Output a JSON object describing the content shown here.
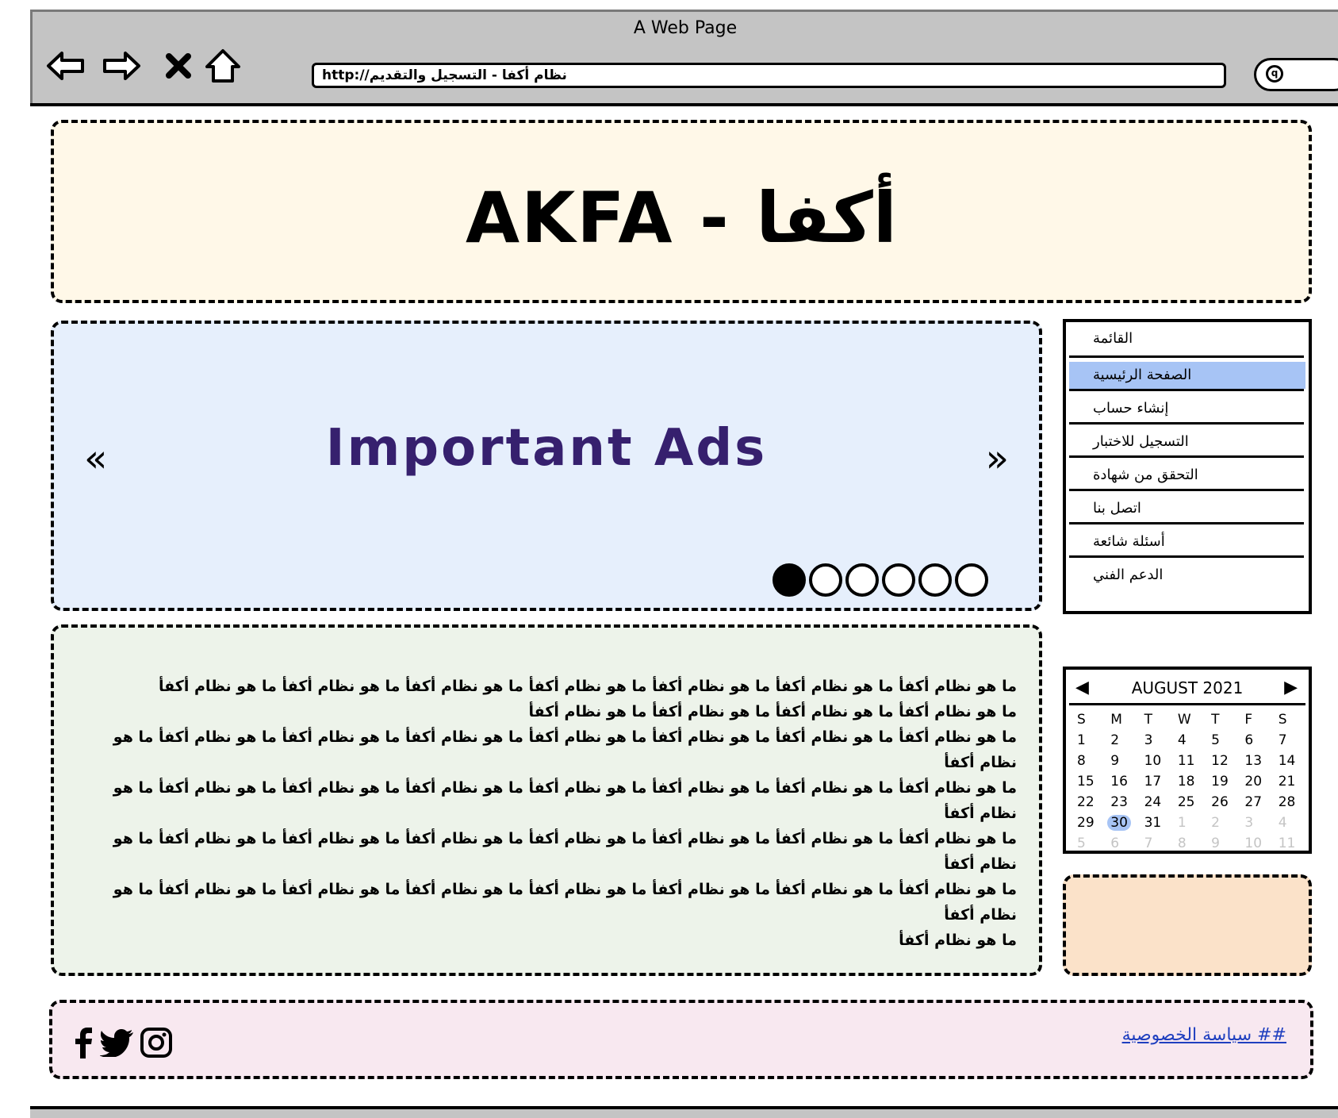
{
  "window": {
    "title": "A Web Page"
  },
  "toolbar": {
    "url": "http://نظام أكفا - التسجيل والتقديم"
  },
  "header": {
    "title": "AKFA - أكفا"
  },
  "ads": {
    "title": "Important Ads",
    "prev_label": "«",
    "next_label": "»",
    "slide_count": 6,
    "active_slide": 1
  },
  "content": {
    "lines": [
      "ما هو نظام أكفأ ما هو نظام أكفأ ما هو نظام أكفأ ما هو نظام أكفأ ما هو نظام أكفأ ما هو نظام أكفأ ما هو نظام أكفأ",
      "ما هو نظام أكفأ ما هو نظام أكفأ ما هو نظام أكفأ ما هو نظام أكفأ",
      "ما هو نظام أكفأ ما هو نظام أكفأ ما هو نظام أكفأ ما هو نظام أكفأ ما هو نظام أكفأ ما هو نظام أكفأ ما هو نظام أكفأ ما هو نظام أكفأ",
      "ما هو نظام أكفأ ما هو نظام أكفأ ما هو نظام أكفأ ما هو نظام أكفأ ما هو نظام أكفأ ما هو نظام أكفأ ما هو نظام أكفأ ما هو نظام أكفأ",
      "ما هو نظام أكفأ ما هو نظام أكفأ ما هو نظام أكفأ ما هو نظام أكفأ ما هو نظام أكفأ ما هو نظام أكفأ ما هو نظام أكفأ ما هو نظام أكفأ",
      "ما هو نظام أكفأ ما هو نظام أكفأ ما هو نظام أكفأ ما هو نظام أكفأ ما هو نظام أكفأ ما هو نظام أكفأ ما هو نظام أكفأ ما هو نظام أكفأ",
      "ما هو نظام أكفأ"
    ]
  },
  "menu": {
    "header": "القائمة",
    "items": [
      {
        "label": "الصفحة الرئيسية",
        "selected": true
      },
      {
        "label": "إنشاء حساب"
      },
      {
        "label": "التسجيل للاختبار"
      },
      {
        "label": "التحقق من شهادة"
      },
      {
        "label": "اتصل بنا"
      },
      {
        "label": "أسئلة شائعة"
      },
      {
        "label": "الدعم الفني"
      }
    ]
  },
  "calendar": {
    "title": "AUGUST 2021",
    "days_of_week": [
      "S",
      "M",
      "T",
      "W",
      "T",
      "F",
      "S"
    ],
    "selected_day": "30",
    "weeks": [
      [
        "1",
        "2",
        "3",
        "4",
        "5",
        "6",
        "7"
      ],
      [
        "8",
        "9",
        "10",
        "11",
        "12",
        "13",
        "14"
      ],
      [
        "15",
        "16",
        "17",
        "18",
        "19",
        "20",
        "21"
      ],
      [
        "22",
        "23",
        "24",
        "25",
        "26",
        "27",
        "28"
      ],
      [
        "29",
        "30",
        "31",
        "1",
        "2",
        "3",
        "4"
      ],
      [
        "5",
        "6",
        "7",
        "8",
        "9",
        "10",
        "11"
      ]
    ],
    "dim_from_index": 31
  },
  "footer": {
    "privacy_link": "## سياسة الخصوصية",
    "social_icons": [
      "facebook-icon",
      "twitter-icon",
      "instagram-icon"
    ]
  }
}
